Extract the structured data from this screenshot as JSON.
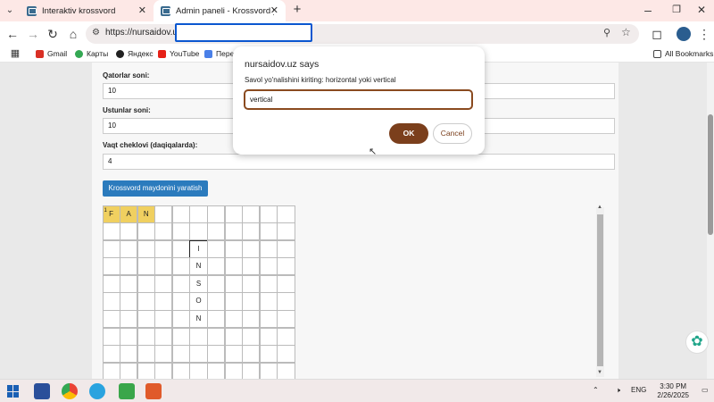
{
  "tabs": [
    {
      "label": "Interaktiv krossvord"
    },
    {
      "label": "Admin paneli - Krossvord yarati"
    }
  ],
  "address": {
    "url": "https://nursaidov.uz"
  },
  "bookmarks": {
    "items": [
      "Gmail",
      "Карты",
      "Яндекс",
      "YouTube",
      "Пере"
    ],
    "all_label": "All Bookmarks"
  },
  "form": {
    "rows_label": "Qatorlar soni:",
    "rows_value": "10",
    "cols_label": "Ustunlar soni:",
    "cols_value": "10",
    "time_label": "Vaqt cheklovi (daqiqalarda):",
    "time_value": "4",
    "generate_button": "Krossvord maydonini yaratish"
  },
  "grid": {
    "rows": 10,
    "cols": 11,
    "filled": [
      {
        "r": 0,
        "c": 0,
        "text": "F",
        "num": "1"
      },
      {
        "r": 0,
        "c": 1,
        "text": "A"
      },
      {
        "r": 0,
        "c": 2,
        "text": "N"
      }
    ],
    "letters": [
      {
        "r": 2,
        "c": 5,
        "text": "I",
        "focus": true
      },
      {
        "r": 3,
        "c": 5,
        "text": "N"
      },
      {
        "r": 4,
        "c": 5,
        "text": "S"
      },
      {
        "r": 5,
        "c": 5,
        "text": "O"
      },
      {
        "r": 6,
        "c": 5,
        "text": "N"
      }
    ]
  },
  "dialog": {
    "title": "nursaidov.uz says",
    "message": "Savol yo'nalishini kiriting: horizontal yoki vertical",
    "input_value": "vertical",
    "ok_label": "OK",
    "cancel_label": "Cancel"
  },
  "taskbar": {
    "lang": "ENG",
    "time": "3:30 PM",
    "date": "2/26/2025"
  }
}
